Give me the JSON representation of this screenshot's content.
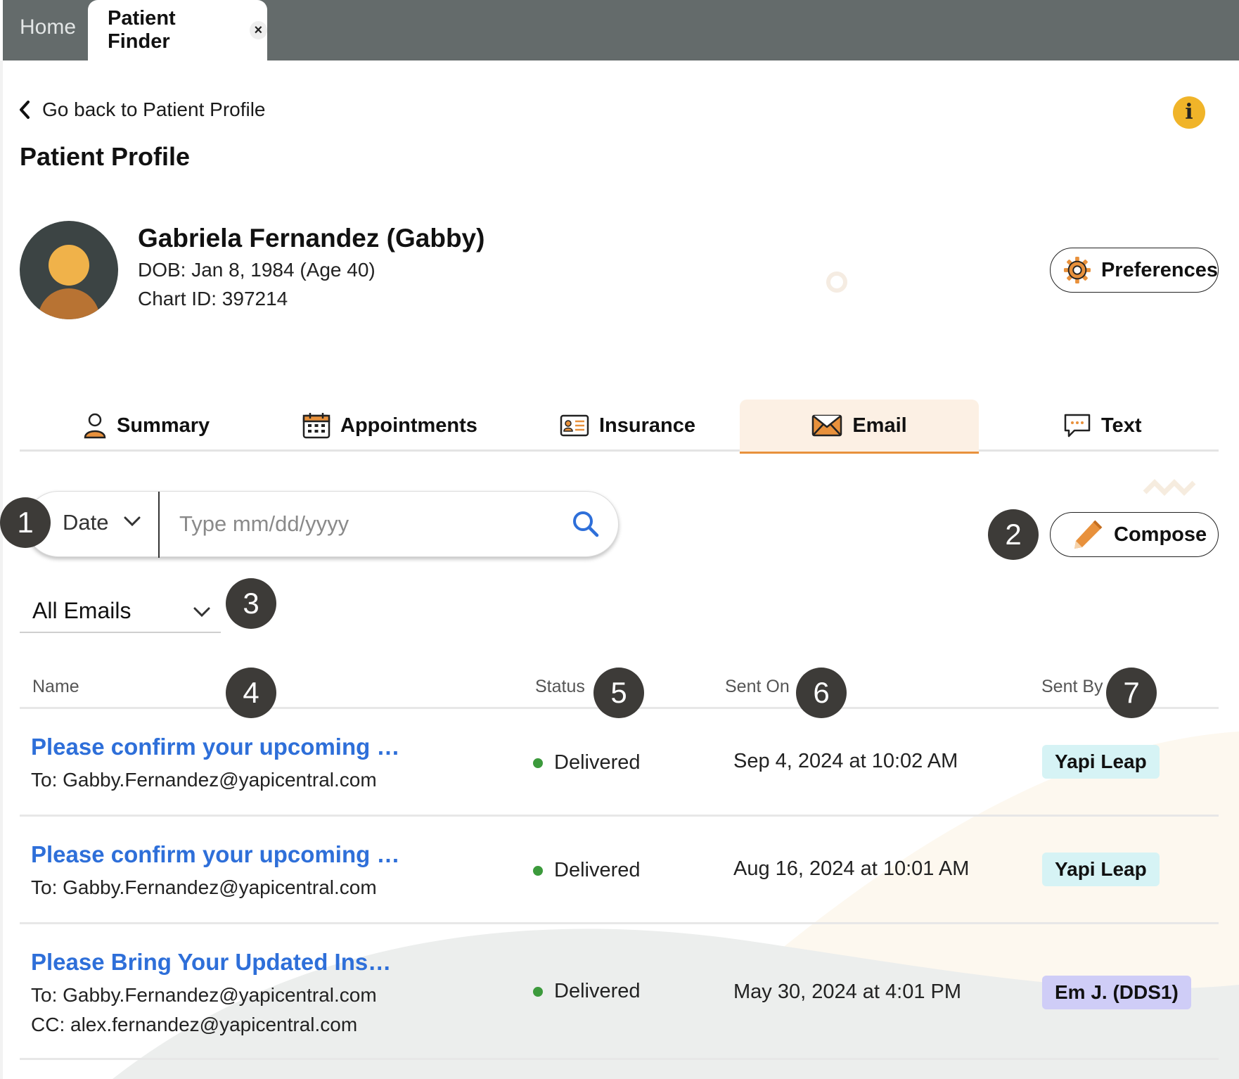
{
  "tabs": {
    "home": "Home",
    "active": "Patient Finder",
    "close": "×"
  },
  "back_link": "Go back to Patient Profile",
  "info_icon": "i",
  "page_title": "Patient Profile",
  "patient": {
    "name": "Gabriela Fernandez (Gabby)",
    "dob": "DOB: Jan 8, 1984 (Age 40)",
    "chart_id": "Chart ID: 397214"
  },
  "preferences_label": "Preferences",
  "nav_tabs": [
    {
      "label": "Summary",
      "icon": "person-icon"
    },
    {
      "label": "Appointments",
      "icon": "calendar-icon"
    },
    {
      "label": "Insurance",
      "icon": "id-card-icon"
    },
    {
      "label": "Email",
      "icon": "envelope-icon",
      "active": true
    },
    {
      "label": "Text",
      "icon": "chat-icon"
    }
  ],
  "search": {
    "filter_label": "Date",
    "placeholder": "Type mm/dd/yyyy"
  },
  "compose_label": "Compose",
  "email_filter": "All Emails",
  "badges": [
    "1",
    "2",
    "3",
    "4",
    "5",
    "6",
    "7"
  ],
  "table": {
    "headers": {
      "name": "Name",
      "status": "Status",
      "sent_on": "Sent On",
      "sent_by": "Sent By"
    },
    "rows": [
      {
        "title": "Please confirm your upcoming …",
        "to": "To: Gabby.Fernandez@yapicentral.com",
        "status": "Delivered",
        "sent_on": "Sep 4, 2024 at 10:02 AM",
        "sent_by": "Yapi Leap"
      },
      {
        "title": "Please confirm your upcoming …",
        "to": "To: Gabby.Fernandez@yapicentral.com",
        "status": "Delivered",
        "sent_on": "Aug 16, 2024 at 10:01 AM",
        "sent_by": "Yapi Leap"
      },
      {
        "title": "Please Bring Your Updated Ins…",
        "to": "To: Gabby.Fernandez@yapicentral.com",
        "cc": "CC: alex.fernandez@yapicentral.com",
        "status": "Delivered",
        "sent_on": "May 30, 2024 at 4:01 PM",
        "sent_by": "Em J. (DDS1)"
      }
    ]
  },
  "colors": {
    "tabbar": "#646b6b",
    "accent_orange": "#e8913c",
    "link_blue": "#2e6fd9",
    "status_green": "#3c9a3c",
    "chip_yapi": "#d6f3f5",
    "chip_em": "#cfcdf7",
    "badge": "#3d3b38"
  }
}
